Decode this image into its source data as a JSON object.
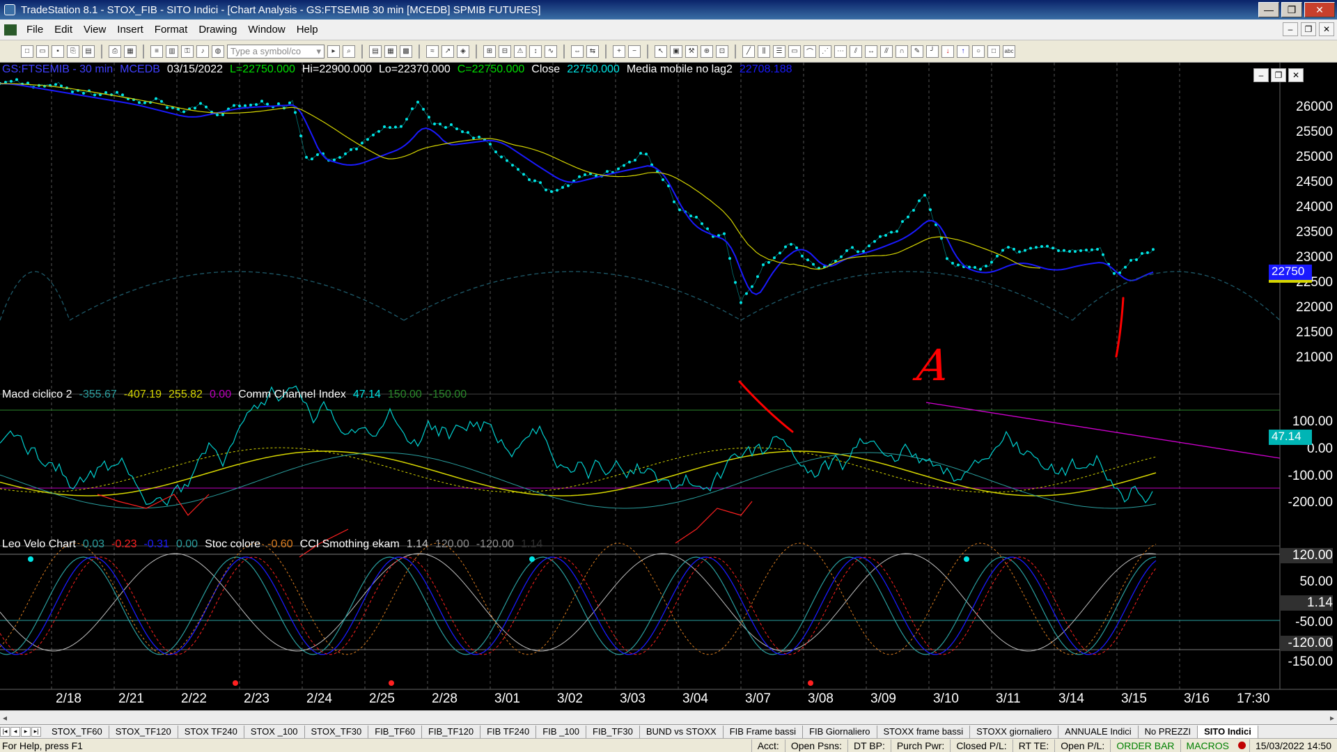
{
  "window": {
    "title": "TradeStation 8.1 - STOX_FIB - SITO Indici - [Chart Analysis - GS:FTSEMIB  30 min  [MCEDB] SPMIB FUTURES]",
    "minimize": "—",
    "maximize": "❐",
    "close": "✕"
  },
  "menu": {
    "items": [
      "File",
      "Edit",
      "View",
      "Insert",
      "Format",
      "Drawing",
      "Window",
      "Help"
    ],
    "mdi_min": "–",
    "mdi_restore": "❐",
    "mdi_close": "✕"
  },
  "toolbar": {
    "symbol_placeholder": "Type a symbol/co",
    "icons": [
      "new-icon",
      "open-icon",
      "save-icon",
      "print-icon",
      "print-preview-icon",
      "format-icon",
      "zoom-in-icon",
      "zoom-out-icon",
      "pointer-icon",
      "trendline-icon",
      "text-icon"
    ]
  },
  "chart_header": {
    "symbol": "GS:FTSEMIB - 30 min",
    "feed": "MCEDB",
    "date": "03/15/2022",
    "last": "L=22750.000",
    "high": "Hi=22900.000",
    "low": "Lo=22370.000",
    "close_val": "C=22750.000",
    "close_label": "Close",
    "close_price": "22750.000",
    "ma_label": "Media mobile no lag2",
    "ma_value": "22708.188"
  },
  "macd_header": {
    "name": "Macd ciclico 2",
    "v1": "-355.67",
    "v2": "-407.19",
    "v3": "255.82",
    "v4": "0.00",
    "cci_name": "Comm Channel Index",
    "cci_val": "47.14",
    "cci_up": "150.00",
    "cci_dn": "-150.00"
  },
  "velo_header": {
    "name": "Leo Velo Chart",
    "v1": "0.03",
    "v2": "-0.23",
    "v3": "-0.31",
    "v4": "0.00",
    "stoc_name": "Stoc colore",
    "stoc_val": "-0.60",
    "cci_name": "CCI Smothing ekam",
    "cci_val": "1.14",
    "cci_up": "120.00",
    "cci_dn": "-120.00",
    "cci_last": "1.14"
  },
  "price_axis": {
    "labels": [
      "26000",
      "25500",
      "25000",
      "24500",
      "24000",
      "23500",
      "23000",
      "22500",
      "22000",
      "21500",
      "21000"
    ],
    "last_price": "22750"
  },
  "macd_axis": {
    "labels": [
      "100.00",
      "0.00",
      "-100.00",
      "-200.00"
    ],
    "last": "47.14"
  },
  "velo_axis": {
    "labels": [
      "120.00",
      "50.00",
      "1.14",
      "-50.00",
      "-120.00",
      "-150.00"
    ]
  },
  "time_axis": {
    "labels": [
      "2/18",
      "2/21",
      "2/22",
      "2/23",
      "2/24",
      "2/25",
      "2/28",
      "3/01",
      "3/02",
      "3/03",
      "3/04",
      "3/07",
      "3/08",
      "3/09",
      "3/10",
      "3/11",
      "3/14",
      "3/15",
      "3/16",
      "17:30"
    ]
  },
  "tabs": [
    "STOX_TF60",
    "STOX_TF120",
    "STOX TF240",
    "STOX _100",
    "STOX_TF30",
    "FIB_TF60",
    "FIB_TF120",
    "FIB TF240",
    "FIB _100",
    "FIB_TF30",
    "BUND vs STOXX",
    "FIB Frame bassi",
    "FIB Giornaliero",
    "STOXX frame bassi",
    "STOXX giornaliero",
    "ANNUALE Indici",
    "No PREZZI",
    "SITO Indici"
  ],
  "active_tab": "SITO Indici",
  "status": {
    "help": "For Help, press F1",
    "acct": "Acct:",
    "open_psns": "Open Psns:",
    "dt_bp": "DT BP:",
    "purch_pwr": "Purch Pwr:",
    "closed_pl": "Closed P/L:",
    "rt_te": "RT TE:",
    "open_pl": "Open P/L:",
    "order_bar": "ORDER BAR",
    "macros": "MACROS",
    "datetime": "15/03/2022 14:50"
  },
  "colors": {
    "price_dots": "#00e5e5",
    "ma_blue": "#1a1aff",
    "ma_yellow": "#d6d600",
    "annotation_red": "#ff0000",
    "magenta_line": "#d000d0"
  },
  "annotations": {
    "letter": "A"
  }
}
